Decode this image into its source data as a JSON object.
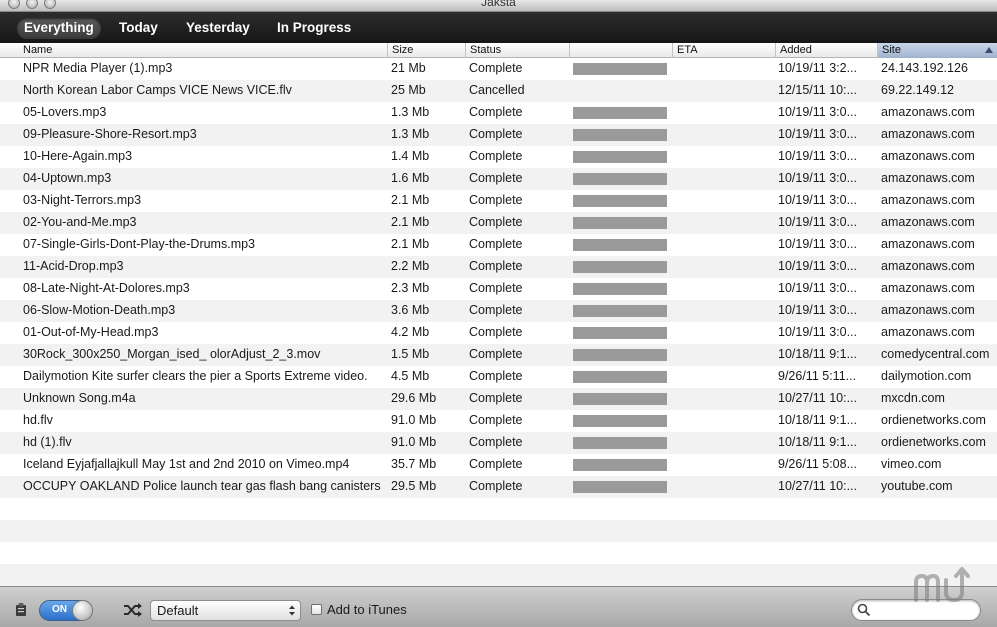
{
  "window": {
    "title": "Jaksta"
  },
  "tabs": [
    {
      "label": "Everything",
      "selected": true
    },
    {
      "label": "Today",
      "selected": false
    },
    {
      "label": "Yesterday",
      "selected": false
    },
    {
      "label": "In Progress",
      "selected": false
    }
  ],
  "columns": {
    "name": "Name",
    "size": "Size",
    "status": "Status",
    "progress": "",
    "eta": "ETA",
    "added": "Added",
    "site": "Site",
    "sorted_column": "site"
  },
  "rows": [
    {
      "name": "NPR Media Player (1).mp3",
      "size": "21 Mb",
      "status": "Complete",
      "progress": 1,
      "eta": "",
      "added": "10/19/11 3:2...",
      "site": "24.143.192.126"
    },
    {
      "name": "North Korean Labor Camps VICE News VICE.flv",
      "size": "25 Mb",
      "status": "Cancelled",
      "progress": 0,
      "eta": "",
      "added": "12/15/11 10:...",
      "site": "69.22.149.12"
    },
    {
      "name": "05-Lovers.mp3",
      "size": "1.3 Mb",
      "status": "Complete",
      "progress": 1,
      "eta": "",
      "added": "10/19/11 3:0...",
      "site": "amazonaws.com"
    },
    {
      "name": "09-Pleasure-Shore-Resort.mp3",
      "size": "1.3 Mb",
      "status": "Complete",
      "progress": 1,
      "eta": "",
      "added": "10/19/11 3:0...",
      "site": "amazonaws.com"
    },
    {
      "name": "10-Here-Again.mp3",
      "size": "1.4 Mb",
      "status": "Complete",
      "progress": 1,
      "eta": "",
      "added": "10/19/11 3:0...",
      "site": "amazonaws.com"
    },
    {
      "name": "04-Uptown.mp3",
      "size": "1.6 Mb",
      "status": "Complete",
      "progress": 1,
      "eta": "",
      "added": "10/19/11 3:0...",
      "site": "amazonaws.com"
    },
    {
      "name": "03-Night-Terrors.mp3",
      "size": "2.1 Mb",
      "status": "Complete",
      "progress": 1,
      "eta": "",
      "added": "10/19/11 3:0...",
      "site": "amazonaws.com"
    },
    {
      "name": "02-You-and-Me.mp3",
      "size": "2.1 Mb",
      "status": "Complete",
      "progress": 1,
      "eta": "",
      "added": "10/19/11 3:0...",
      "site": "amazonaws.com"
    },
    {
      "name": "07-Single-Girls-Dont-Play-the-Drums.mp3",
      "size": "2.1 Mb",
      "status": "Complete",
      "progress": 1,
      "eta": "",
      "added": "10/19/11 3:0...",
      "site": "amazonaws.com"
    },
    {
      "name": "11-Acid-Drop.mp3",
      "size": "2.2 Mb",
      "status": "Complete",
      "progress": 1,
      "eta": "",
      "added": "10/19/11 3:0...",
      "site": "amazonaws.com"
    },
    {
      "name": "08-Late-Night-At-Dolores.mp3",
      "size": "2.3 Mb",
      "status": "Complete",
      "progress": 1,
      "eta": "",
      "added": "10/19/11 3:0...",
      "site": "amazonaws.com"
    },
    {
      "name": "06-Slow-Motion-Death.mp3",
      "size": "3.6 Mb",
      "status": "Complete",
      "progress": 1,
      "eta": "",
      "added": "10/19/11 3:0...",
      "site": "amazonaws.com"
    },
    {
      "name": "01-Out-of-My-Head.mp3",
      "size": "4.2 Mb",
      "status": "Complete",
      "progress": 1,
      "eta": "",
      "added": "10/19/11 3:0...",
      "site": "amazonaws.com"
    },
    {
      "name": "30Rock_300x250_Morgan_ised_ olorAdjust_2_3.mov",
      "size": "1.5 Mb",
      "status": "Complete",
      "progress": 1,
      "eta": "",
      "added": "10/18/11 9:1...",
      "site": "comedycentral.com"
    },
    {
      "name": "Dailymotion Kite surfer clears the pier a Sports Extreme video.",
      "size": "4.5 Mb",
      "status": "Complete",
      "progress": 1,
      "eta": "",
      "added": "9/26/11 5:11...",
      "site": "dailymotion.com"
    },
    {
      "name": "Unknown Song.m4a",
      "size": "29.6 Mb",
      "status": "Complete",
      "progress": 1,
      "eta": "",
      "added": "10/27/11 10:...",
      "site": "mxcdn.com"
    },
    {
      "name": "hd.flv",
      "size": "91.0 Mb",
      "status": "Complete",
      "progress": 1,
      "eta": "",
      "added": "10/18/11 9:1...",
      "site": "ordienetworks.com"
    },
    {
      "name": "hd (1).flv",
      "size": "91.0 Mb",
      "status": "Complete",
      "progress": 1,
      "eta": "",
      "added": "10/18/11 9:1...",
      "site": "ordienetworks.com"
    },
    {
      "name": "Iceland Eyjafjallajkull May 1st and 2nd 2010 on Vimeo.mp4",
      "size": "35.7 Mb",
      "status": "Complete",
      "progress": 1,
      "eta": "",
      "added": "9/26/11 5:08...",
      "site": "vimeo.com"
    },
    {
      "name": "OCCUPY OAKLAND Police launch tear gas flash bang canisters",
      "size": "29.5 Mb",
      "status": "Complete",
      "progress": 1,
      "eta": "",
      "added": "10/27/11 10:...",
      "site": "youtube.com"
    }
  ],
  "bottombar": {
    "toggle_label": "ON",
    "toggle_on": true,
    "profile_select": "Default",
    "add_to_itunes_label": "Add to iTunes",
    "add_to_itunes_checked": false,
    "search_value": "",
    "search_placeholder": ""
  },
  "icons": {
    "clipboard": "clipboard-icon",
    "shuffle": "shuffle-icon",
    "search": "search-icon",
    "watermark": "macupdate-logo"
  },
  "colors": {
    "tabbar_bg": "#1e1e1e",
    "progress_bar": "#9a9a9a",
    "toggle_on": "#2a6fc8",
    "sorted_header": "#b3c4dd"
  }
}
